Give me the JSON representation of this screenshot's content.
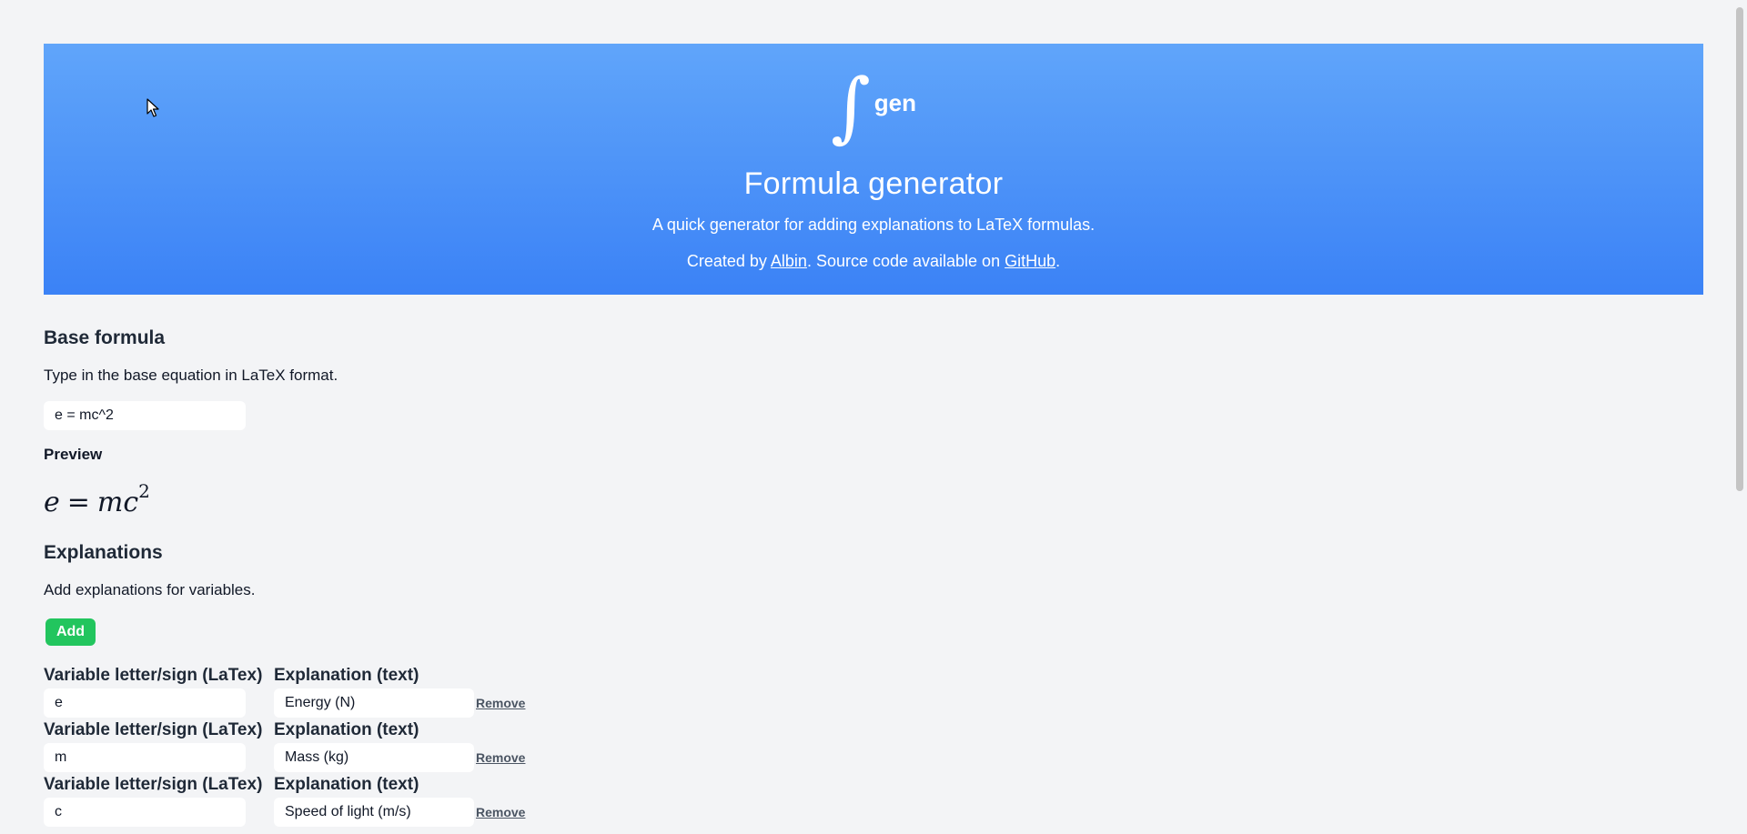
{
  "hero": {
    "logo_symbol": "∫",
    "logo_text": "gen",
    "title": "Formula generator",
    "subtitle": "A quick generator for adding explanations to LaTeX formulas.",
    "credits_prefix": "Created by ",
    "author_link": "Albin",
    "credits_middle": ". Source code available on ",
    "github_link": "GitHub",
    "credits_suffix": ".",
    "gradient_top": "#60a5fa",
    "gradient_bottom": "#3b82f6"
  },
  "base_formula": {
    "title": "Base formula",
    "description": "Type in the base equation in LaTeX format.",
    "input_value": "e = mc^2",
    "preview_label": "Preview",
    "preview_lhs": "e",
    "preview_eq": "=",
    "preview_rhs": "mc",
    "preview_exponent": "2"
  },
  "explanations": {
    "title": "Explanations",
    "description": "Add explanations for variables.",
    "add_label": "Add",
    "add_color": "#22c55e",
    "variable_header": "Variable letter/sign (LaTex)",
    "explanation_header": "Explanation (text)",
    "remove_label": "Remove",
    "rows": [
      {
        "variable": "e",
        "explanation": "Energy (N)"
      },
      {
        "variable": "m",
        "explanation": "Mass (kg)"
      },
      {
        "variable": "c",
        "explanation": "Speed of light (m/s)"
      }
    ]
  },
  "icons": {
    "cursor": "mouse-pointer-icon"
  }
}
